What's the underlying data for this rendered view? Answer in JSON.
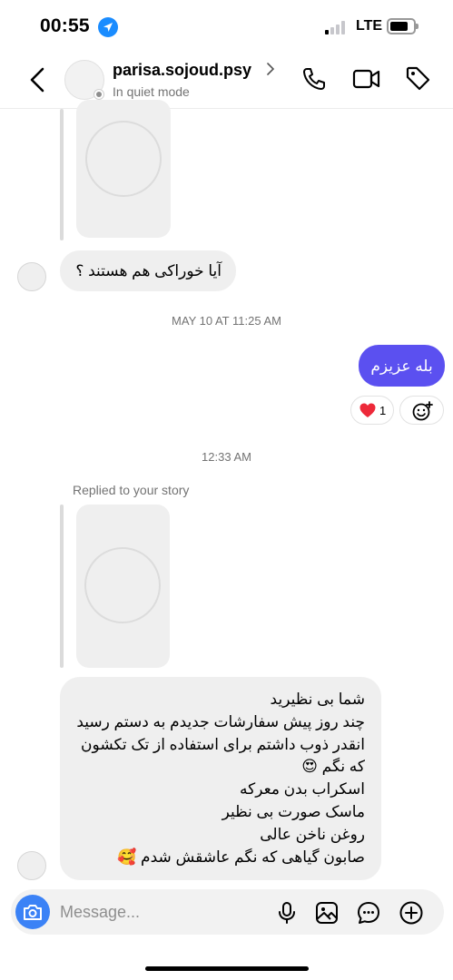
{
  "status_bar": {
    "time": "00:55",
    "network": "LTE",
    "icons": [
      "location-arrow-icon",
      "signal-bars-icon",
      "battery-icon"
    ]
  },
  "header": {
    "username": "parisa.sojoud.psy",
    "status": "In quiet mode",
    "icons": [
      "back-chevron-icon",
      "phone-icon",
      "video-camera-icon",
      "tag-icon"
    ]
  },
  "messages": {
    "incoming_question": "آیا خوراکی هم هستند ؟",
    "timestamp_1": "MAY 10 AT 11:25 AM",
    "outgoing_reply": "بله عزیزم",
    "reaction": {
      "emoji": "❤️",
      "count": "1"
    },
    "timestamp_2": "12:33 AM",
    "replied_label": "Replied to your story",
    "long_message_lines": [
      "شما بی نظیرید",
      "چند روز پیش سفارشات جدیدم به دستم رسید",
      "انقدر ذوب داشتم برای استفاده از تک تکشون",
      "که نگم 😍",
      "اسکراب بدن معرکه",
      "ماسک صورت بی نظیر",
      "روغن ناخن عالی",
      "صابون گیاهی که نگم عاشقش شدم 🥰"
    ]
  },
  "composer": {
    "placeholder": "Message...",
    "icons": [
      "camera-icon",
      "microphone-icon",
      "gallery-icon",
      "chat-sticker-icon",
      "plus-icon"
    ]
  },
  "colors": {
    "outgoing_bubble": "#5b50f0",
    "incoming_bubble": "#efefef",
    "camera_button": "#3b82f6",
    "location_icon": "#1a8cff"
  }
}
